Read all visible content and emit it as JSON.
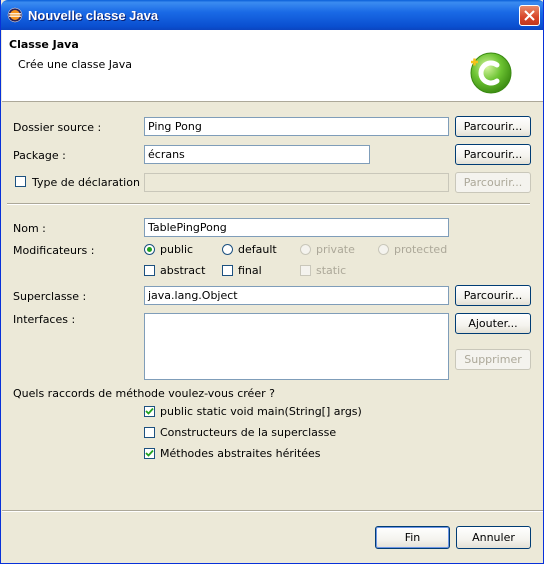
{
  "window": {
    "title": "Nouvelle classe Java"
  },
  "header": {
    "title": "Classe Java",
    "description": "Crée une classe Java"
  },
  "source_folder": {
    "label": "Dossier source :",
    "value": "Ping Pong",
    "browse": "Parcourir..."
  },
  "package": {
    "label": "Package :",
    "value": "écrans",
    "browse": "Parcourir..."
  },
  "enclosing_type": {
    "label": "Type de déclaration :",
    "value": "",
    "checked": false,
    "browse": "Parcourir..."
  },
  "name": {
    "label": "Nom :",
    "value": "TablePingPong"
  },
  "modifiers": {
    "label": "Modificateurs :",
    "access": [
      {
        "label": "public",
        "selected": true,
        "enabled": true
      },
      {
        "label": "default",
        "selected": false,
        "enabled": true
      },
      {
        "label": "private",
        "selected": false,
        "enabled": false
      },
      {
        "label": "protected",
        "selected": false,
        "enabled": false
      }
    ],
    "flags": [
      {
        "label": "abstract",
        "checked": false,
        "enabled": true
      },
      {
        "label": "final",
        "checked": false,
        "enabled": true
      },
      {
        "label": "static",
        "checked": false,
        "enabled": false
      }
    ]
  },
  "superclass": {
    "label": "Superclasse :",
    "value": "java.lang.Object",
    "browse": "Parcourir..."
  },
  "interfaces": {
    "label": "Interfaces :",
    "add": "Ajouter...",
    "remove": "Supprimer"
  },
  "stubs": {
    "question": "Quels raccords de méthode voulez-vous créer ?",
    "options": [
      {
        "label": "public static void main(String[] args)",
        "checked": true
      },
      {
        "label": "Constructeurs de la superclasse",
        "checked": false
      },
      {
        "label": "Méthodes abstraites héritées",
        "checked": true
      }
    ]
  },
  "footer": {
    "finish": "Fin",
    "cancel": "Annuler"
  },
  "colors": {
    "titlebar": "#0a4fd0",
    "dialog": "#ece9d8",
    "radio_dot": "#21a121",
    "logo": "#5fb82a"
  }
}
